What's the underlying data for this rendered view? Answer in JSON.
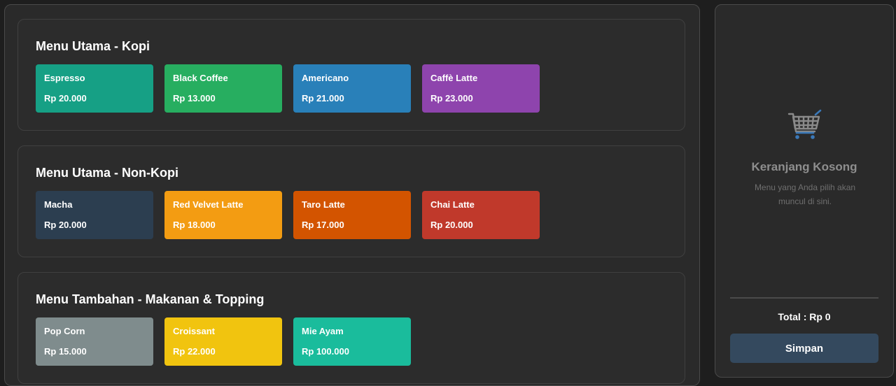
{
  "sections": [
    {
      "title": "Menu Utama - Kopi",
      "items": [
        {
          "name": "Espresso",
          "price": "Rp 20.000",
          "color": "#16a085"
        },
        {
          "name": "Black Coffee",
          "price": "Rp 13.000",
          "color": "#27ae60"
        },
        {
          "name": "Americano",
          "price": "Rp 21.000",
          "color": "#2980b9"
        },
        {
          "name": "Caffè Latte",
          "price": "Rp 23.000",
          "color": "#8e44ad"
        }
      ]
    },
    {
      "title": "Menu Utama - Non-Kopi",
      "items": [
        {
          "name": "Macha",
          "price": "Rp 20.000",
          "color": "#2c3e50"
        },
        {
          "name": "Red Velvet Latte",
          "price": "Rp 18.000",
          "color": "#f39c12"
        },
        {
          "name": "Taro Latte",
          "price": "Rp 17.000",
          "color": "#d35400"
        },
        {
          "name": "Chai Latte",
          "price": "Rp 20.000",
          "color": "#c0392b"
        }
      ]
    },
    {
      "title": "Menu Tambahan - Makanan & Topping",
      "items": [
        {
          "name": "Pop Corn",
          "price": "Rp 15.000",
          "color": "#7f8c8d"
        },
        {
          "name": "Croissant",
          "price": "Rp 22.000",
          "color": "#f1c40f"
        },
        {
          "name": "Mie Ayam",
          "price": "Rp 100.000",
          "color": "#1abc9c"
        }
      ]
    }
  ],
  "cart": {
    "icon": "shopping-cart-icon",
    "empty_title": "Keranjang Kosong",
    "empty_description": "Menu yang Anda pilih akan muncul di sini.",
    "total": "Total : Rp 0",
    "save_label": "Simpan"
  }
}
